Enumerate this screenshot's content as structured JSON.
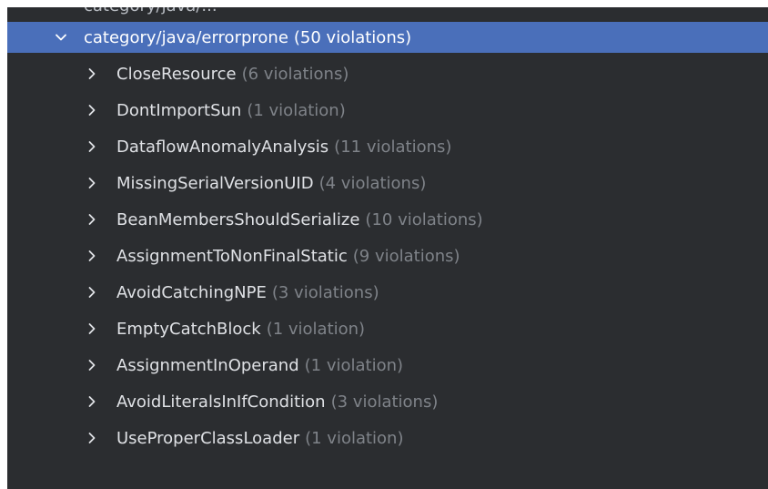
{
  "tree": {
    "clipped_label": "category/java/...",
    "parent": {
      "label": "category/java/errorprone",
      "count": "(50 violations)"
    },
    "items": [
      {
        "label": "CloseResource",
        "count": "(6 violations)"
      },
      {
        "label": "DontImportSun",
        "count": "(1 violation)"
      },
      {
        "label": "DataflowAnomalyAnalysis",
        "count": "(11 violations)"
      },
      {
        "label": "MissingSerialVersionUID",
        "count": "(4 violations)"
      },
      {
        "label": "BeanMembersShouldSerialize",
        "count": "(10 violations)"
      },
      {
        "label": "AssignmentToNonFinalStatic",
        "count": "(9 violations)"
      },
      {
        "label": "AvoidCatchingNPE",
        "count": "(3 violations)"
      },
      {
        "label": "EmptyCatchBlock",
        "count": "(1 violation)"
      },
      {
        "label": "AssignmentInOperand",
        "count": "(1 violation)"
      },
      {
        "label": "AvoidLiteralsInIfCondition",
        "count": "(3 violations)"
      },
      {
        "label": "UseProperClassLoader",
        "count": "(1 violation)"
      }
    ]
  },
  "colors": {
    "background": "#2b2d30",
    "selection": "#4a6fba",
    "text": "#dfe1e5",
    "muted": "#7f8389"
  },
  "icons": {
    "expanded": "chevron-down-icon",
    "collapsed": "chevron-right-icon"
  }
}
